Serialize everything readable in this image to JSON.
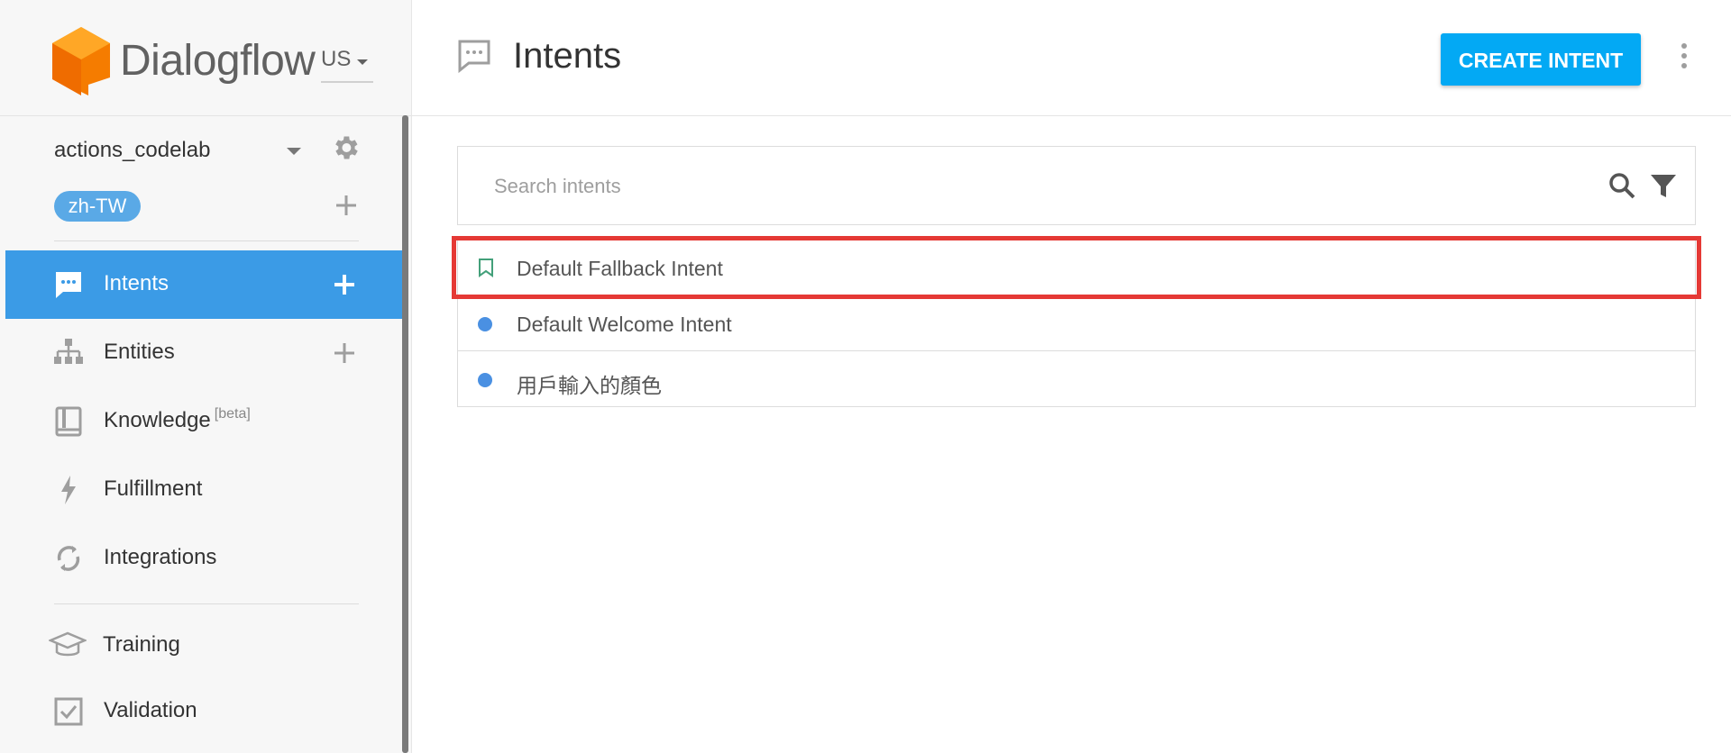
{
  "app": {
    "brand_name": "Dialogflow",
    "region": "US",
    "brand_color": "#ef6c00"
  },
  "sidebar": {
    "agent_name": "actions_codelab",
    "language_chip": "zh-TW",
    "nav": [
      {
        "label": "Intents",
        "icon": "speech-bubble-icon",
        "active": true,
        "has_add": true
      },
      {
        "label": "Entities",
        "icon": "hierarchy-icon",
        "active": false,
        "has_add": true
      },
      {
        "label": "Knowledge",
        "badge": "[beta]",
        "icon": "book-icon",
        "active": false
      },
      {
        "label": "Fulfillment",
        "icon": "lightning-icon",
        "active": false
      },
      {
        "label": "Integrations",
        "icon": "sync-icon",
        "active": false
      },
      {
        "label": "Training",
        "icon": "graduation-cap-icon",
        "active": false
      },
      {
        "label": "Validation",
        "icon": "checkbox-icon",
        "active": false
      }
    ],
    "active_color": "#3b9be6"
  },
  "header": {
    "title": "Intents",
    "create_button": "CREATE INTENT",
    "button_color": "#03a9f4"
  },
  "search": {
    "placeholder": "Search intents",
    "value": ""
  },
  "intents": [
    {
      "label": "Default Fallback Intent",
      "marker": "bookmark-icon",
      "highlighted": true
    },
    {
      "label": "Default Welcome Intent",
      "marker": "dot-icon"
    },
    {
      "label": "用戶輸入的顏色",
      "marker": "dot-icon"
    }
  ],
  "highlight_color": "#e53935"
}
